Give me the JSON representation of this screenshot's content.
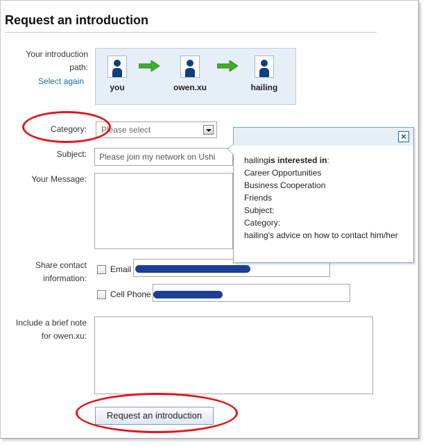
{
  "page": {
    "title": "Request an introduction"
  },
  "path": {
    "label": "Your introduction path:",
    "select_again": "Select again",
    "nodes": [
      {
        "name": "you"
      },
      {
        "name": "owen.xu"
      },
      {
        "name": "hailing"
      }
    ],
    "arrow_color": "#3fae29"
  },
  "form": {
    "category_label": "Category:",
    "category_value": "Please select",
    "subject_label": "Subject:",
    "subject_value": "Please join my network on Ushi",
    "message_label": "Your Message:",
    "share_label_1": "Share contact",
    "share_label_2": "information:",
    "email_label": "Email",
    "cell_label": "Cell Phone",
    "note_label_1": "Include a brief note",
    "note_label_2": "for owen.xu:",
    "submit_label": "Request an introduction"
  },
  "popup": {
    "close_symbol": "×",
    "header_name": "hailing",
    "header_rest": "is interested in",
    "header_colon": ":",
    "lines": [
      "Career Opportunities",
      "Business Cooperation",
      "Friends",
      "Subject:",
      "Category:",
      "hailing's advice on how to contact him/her"
    ]
  },
  "colors": {
    "highlight": "#e2151b",
    "redaction": "#1b3f94",
    "link": "#1e6ca8"
  }
}
